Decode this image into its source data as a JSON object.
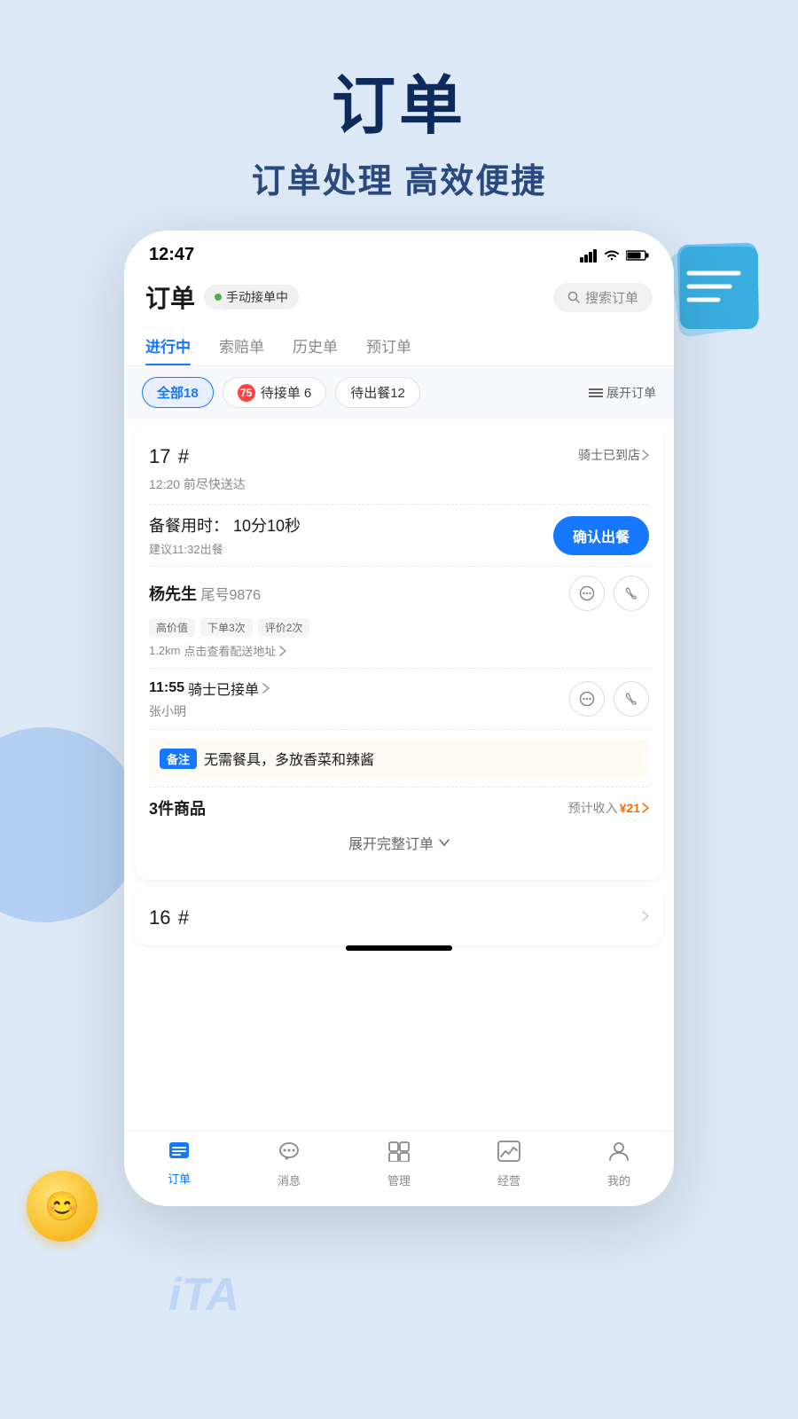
{
  "page": {
    "background_color": "#dde9f7"
  },
  "header": {
    "title": "订单",
    "subtitle": "订单处理 高效便捷"
  },
  "phone": {
    "status_bar": {
      "time": "12:47"
    },
    "app_header": {
      "title": "订单",
      "status_label": "手动接单中",
      "search_placeholder": "搜索订单"
    },
    "tabs": [
      {
        "label": "进行中",
        "active": true
      },
      {
        "label": "索赔单",
        "active": false
      },
      {
        "label": "历史单",
        "active": false
      },
      {
        "label": "预订单",
        "active": false
      }
    ],
    "filters": [
      {
        "label": "全部18",
        "type": "active"
      },
      {
        "label": "待接单 6",
        "badge": "75",
        "type": "normal"
      },
      {
        "label": "待出餐12",
        "type": "normal"
      }
    ],
    "expand_orders_label": "展开订单",
    "order_17": {
      "number": "17",
      "hash": "#",
      "rider_status": "骑士已到店",
      "delivery_note": "12:20 前尽快送达",
      "prep_time_label": "备餐用时：",
      "prep_time_value": "10分10秒",
      "confirm_btn_label": "确认出餐",
      "suggest_time": "建议11:32出餐",
      "customer_name": "杨先生",
      "customer_id": "尾号9876",
      "tags": [
        "高价值",
        "下单3次",
        "评价2次"
      ],
      "distance": "1.2km",
      "delivery_address_label": "点击查看配送地址",
      "rider_time": "11:55",
      "rider_status_detail": "骑士已接单",
      "rider_name": "张小明",
      "remark_tag": "备注",
      "remark_text": "无需餐具，多放香菜和辣酱",
      "item_count": "3件商品",
      "expected_income_label": "预计收入",
      "expected_income": "¥21",
      "expand_label": "展开完整订单"
    },
    "order_16": {
      "number": "16",
      "hash": "#"
    },
    "bottom_nav": [
      {
        "label": "订单",
        "active": true,
        "icon": "≡"
      },
      {
        "label": "消息",
        "active": false,
        "icon": "💬"
      },
      {
        "label": "管理",
        "active": false,
        "icon": "⊞"
      },
      {
        "label": "经营",
        "active": false,
        "icon": "📈"
      },
      {
        "label": "我的",
        "active": false,
        "icon": "👤"
      }
    ]
  }
}
